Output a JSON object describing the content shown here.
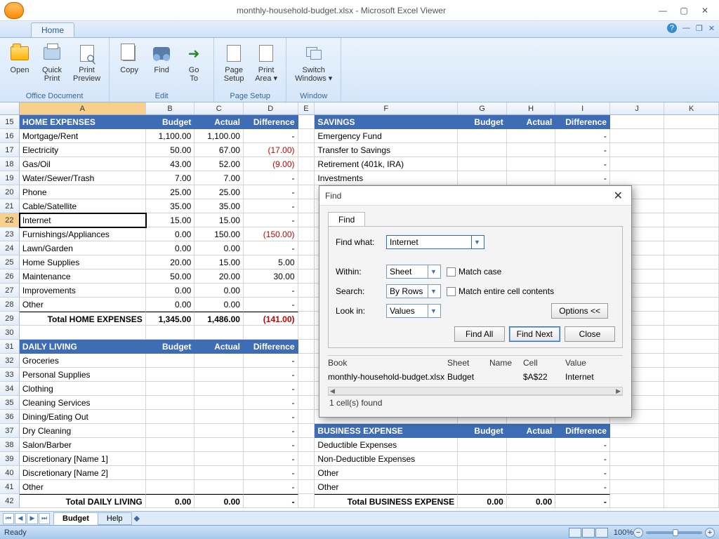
{
  "window": {
    "title": "monthly-household-budget.xlsx - Microsoft Excel Viewer"
  },
  "tabs": {
    "home": "Home"
  },
  "ribbon": {
    "office_document": {
      "label": "Office Document",
      "open": "Open",
      "quick_print": "Quick\nPrint",
      "print_preview": "Print\nPreview"
    },
    "edit": {
      "label": "Edit",
      "copy": "Copy",
      "find": "Find",
      "goto": "Go\nTo"
    },
    "page_setup": {
      "label": "Page Setup",
      "page_setup": "Page\nSetup",
      "print_area": "Print\nArea ▾"
    },
    "window_grp": {
      "label": "Window",
      "switch": "Switch\nWindows ▾"
    }
  },
  "columns": [
    "A",
    "B",
    "C",
    "D",
    "E",
    "F",
    "G",
    "H",
    "I",
    "J",
    "K"
  ],
  "rows_start": 15,
  "left_block1": {
    "header": {
      "title": "HOME EXPENSES",
      "budget": "Budget",
      "actual": "Actual",
      "diff": "Difference"
    },
    "rows": [
      {
        "n": "16",
        "a": "Mortgage/Rent",
        "b": "1,100.00",
        "c": "1,100.00",
        "d": "-"
      },
      {
        "n": "17",
        "a": "Electricity",
        "b": "50.00",
        "c": "67.00",
        "d": "(17.00)",
        "neg": true
      },
      {
        "n": "18",
        "a": "Gas/Oil",
        "b": "43.00",
        "c": "52.00",
        "d": "(9.00)",
        "neg": true
      },
      {
        "n": "19",
        "a": "Water/Sewer/Trash",
        "b": "7.00",
        "c": "7.00",
        "d": "-"
      },
      {
        "n": "20",
        "a": "Phone",
        "b": "25.00",
        "c": "25.00",
        "d": "-"
      },
      {
        "n": "21",
        "a": "Cable/Satellite",
        "b": "35.00",
        "c": "35.00",
        "d": "-"
      },
      {
        "n": "22",
        "a": "Internet",
        "b": "15.00",
        "c": "15.00",
        "d": "-",
        "active": true
      },
      {
        "n": "23",
        "a": "Furnishings/Appliances",
        "b": "0.00",
        "c": "150.00",
        "d": "(150.00)",
        "neg": true
      },
      {
        "n": "24",
        "a": "Lawn/Garden",
        "b": "0.00",
        "c": "0.00",
        "d": "-"
      },
      {
        "n": "25",
        "a": "Home Supplies",
        "b": "20.00",
        "c": "15.00",
        "d": "5.00"
      },
      {
        "n": "26",
        "a": "Maintenance",
        "b": "50.00",
        "c": "20.00",
        "d": "30.00"
      },
      {
        "n": "27",
        "a": "Improvements",
        "b": "0.00",
        "c": "0.00",
        "d": "-"
      },
      {
        "n": "28",
        "a": "Other",
        "b": "0.00",
        "c": "0.00",
        "d": "-"
      }
    ],
    "total": {
      "n": "29",
      "a": "Total HOME EXPENSES",
      "b": "1,345.00",
      "c": "1,486.00",
      "d": "(141.00)",
      "neg": true
    }
  },
  "gap_row": "30",
  "left_block2": {
    "header": {
      "n": "31",
      "title": "DAILY LIVING",
      "budget": "Budget",
      "actual": "Actual",
      "diff": "Difference"
    },
    "rows": [
      {
        "n": "32",
        "a": "Groceries",
        "d": "-"
      },
      {
        "n": "33",
        "a": "Personal Supplies",
        "d": "-"
      },
      {
        "n": "34",
        "a": "Clothing",
        "d": "-"
      },
      {
        "n": "35",
        "a": "Cleaning Services",
        "d": "-"
      },
      {
        "n": "36",
        "a": "Dining/Eating Out",
        "d": "-"
      },
      {
        "n": "37",
        "a": "Dry Cleaning",
        "d": "-"
      },
      {
        "n": "38",
        "a": "Salon/Barber",
        "d": "-"
      },
      {
        "n": "39",
        "a": "Discretionary [Name 1]",
        "d": "-"
      },
      {
        "n": "40",
        "a": "Discretionary [Name 2]",
        "d": "-"
      },
      {
        "n": "41",
        "a": "Other",
        "d": "-"
      }
    ],
    "total": {
      "n": "42",
      "a": "Total DAILY LIVING",
      "b": "0.00",
      "c": "0.00",
      "d": "-"
    }
  },
  "right_block1": {
    "header": {
      "title": "SAVINGS",
      "budget": "Budget",
      "actual": "Actual",
      "diff": "Difference"
    },
    "rows": [
      {
        "f": "Emergency Fund",
        "i": "-"
      },
      {
        "f": "Transfer to Savings",
        "i": "-"
      },
      {
        "f": "Retirement (401k, IRA)",
        "i": "-"
      },
      {
        "f": "Investments",
        "i": "-"
      }
    ]
  },
  "right_block2": {
    "header": {
      "title": "BUSINESS EXPENSE",
      "budget": "Budget",
      "actual": "Actual",
      "diff": "Difference"
    },
    "rows": [
      {
        "f": "Deductible Expenses",
        "i": "-"
      },
      {
        "f": "Non-Deductible Expenses",
        "i": "-"
      },
      {
        "f": "Other",
        "i": "-"
      },
      {
        "f": "Other",
        "i": "-"
      }
    ],
    "total": {
      "f": "Total BUSINESS EXPENSE",
      "g": "0.00",
      "h": "0.00",
      "i": "-"
    }
  },
  "sheets": {
    "active": "Budget",
    "other": "Help"
  },
  "status": {
    "ready": "Ready",
    "zoom": "100%"
  },
  "find": {
    "title": "Find",
    "tab": "Find",
    "find_what_label": "Find what:",
    "find_what_value": "Internet",
    "within_label": "Within:",
    "within_value": "Sheet",
    "search_label": "Search:",
    "search_value": "By Rows",
    "lookin_label": "Look in:",
    "lookin_value": "Values",
    "match_case": "Match case",
    "match_entire": "Match entire cell contents",
    "options": "Options <<",
    "find_all": "Find All",
    "find_next": "Find Next",
    "close": "Close",
    "res_hdr": {
      "book": "Book",
      "sheet": "Sheet",
      "name": "Name",
      "cell": "Cell",
      "value": "Value"
    },
    "res_row": {
      "book": "monthly-household-budget.xlsx",
      "sheet": "Budget",
      "name": "",
      "cell": "$A$22",
      "value": "Internet"
    },
    "res_status": "1 cell(s) found"
  }
}
